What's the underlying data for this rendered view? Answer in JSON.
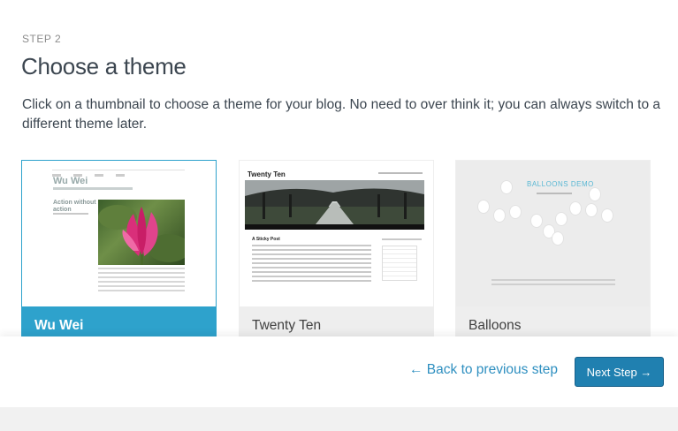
{
  "step": {
    "label": "STEP 2"
  },
  "title": "Choose a theme",
  "intro": "Click on a thumbnail to choose a theme for your blog. No need to over think it; you can always switch to a different theme later.",
  "themes": [
    {
      "name": "Wu Wei",
      "selected": true,
      "thumb_title": "Wu Wei",
      "thumb_post": "Action without action"
    },
    {
      "name": "Twenty Ten",
      "selected": false,
      "thumb_title": "Twenty Ten",
      "thumb_post": "A Sticky Post"
    },
    {
      "name": "Balloons",
      "selected": false,
      "thumb_title": "BALLOONS DEMO"
    }
  ],
  "footer": {
    "back_label": "← Back to previous step",
    "next_label": "Next Step →"
  },
  "colors": {
    "accent": "#2ea2cc",
    "button": "#2080b0",
    "link": "#2e8fc0"
  }
}
